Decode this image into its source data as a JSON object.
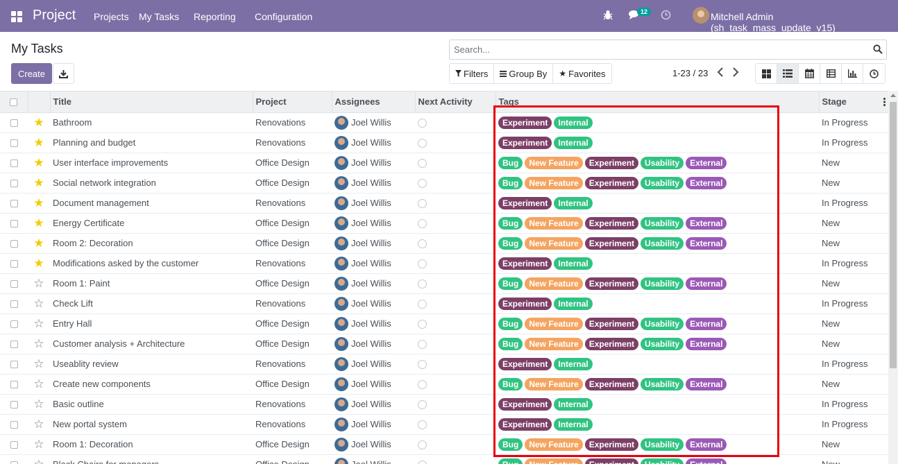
{
  "navbar": {
    "brand": "Project",
    "menu": [
      "Projects",
      "My Tasks",
      "Reporting",
      "Configuration"
    ],
    "messages_count": "12",
    "user": "Mitchell Admin (sh_task_mass_update_v15)"
  },
  "control": {
    "page_title": "My Tasks",
    "search_placeholder": "Search...",
    "create_label": "Create",
    "filters_label": "Filters",
    "groupby_label": "Group By",
    "favorites_label": "Favorites",
    "pager": "1-23 / 23"
  },
  "table": {
    "headers": [
      "Title",
      "Project",
      "Assignees",
      "Next Activity",
      "Tags",
      "Stage"
    ],
    "tag_colors": {
      "Experiment": "#7c3f66",
      "Internal": "#30c381",
      "Bug": "#30c381",
      "New Feature": "#f4a460",
      "Usability": "#30c381",
      "External": "#9b59b6"
    },
    "rows": [
      {
        "starred": true,
        "title": "Bathroom",
        "project": "Renovations",
        "assignee": "Joel Willis",
        "tags": [
          "Experiment",
          "Internal"
        ],
        "stage": "In Progress"
      },
      {
        "starred": true,
        "title": "Planning and budget",
        "project": "Renovations",
        "assignee": "Joel Willis",
        "tags": [
          "Experiment",
          "Internal"
        ],
        "stage": "In Progress"
      },
      {
        "starred": true,
        "title": "User interface improvements",
        "project": "Office Design",
        "assignee": "Joel Willis",
        "tags": [
          "Bug",
          "New Feature",
          "Experiment",
          "Usability",
          "External"
        ],
        "stage": "New"
      },
      {
        "starred": true,
        "title": "Social network integration",
        "project": "Office Design",
        "assignee": "Joel Willis",
        "tags": [
          "Bug",
          "New Feature",
          "Experiment",
          "Usability",
          "External"
        ],
        "stage": "New"
      },
      {
        "starred": true,
        "title": "Document management",
        "project": "Renovations",
        "assignee": "Joel Willis",
        "tags": [
          "Experiment",
          "Internal"
        ],
        "stage": "In Progress"
      },
      {
        "starred": true,
        "title": "Energy Certificate",
        "project": "Office Design",
        "assignee": "Joel Willis",
        "tags": [
          "Bug",
          "New Feature",
          "Experiment",
          "Usability",
          "External"
        ],
        "stage": "New"
      },
      {
        "starred": true,
        "title": "Room 2: Decoration",
        "project": "Office Design",
        "assignee": "Joel Willis",
        "tags": [
          "Bug",
          "New Feature",
          "Experiment",
          "Usability",
          "External"
        ],
        "stage": "New"
      },
      {
        "starred": true,
        "title": "Modifications asked by the customer",
        "project": "Renovations",
        "assignee": "Joel Willis",
        "tags": [
          "Experiment",
          "Internal"
        ],
        "stage": "In Progress"
      },
      {
        "starred": false,
        "title": "Room 1: Paint",
        "project": "Office Design",
        "assignee": "Joel Willis",
        "tags": [
          "Bug",
          "New Feature",
          "Experiment",
          "Usability",
          "External"
        ],
        "stage": "New"
      },
      {
        "starred": false,
        "title": "Check Lift",
        "project": "Renovations",
        "assignee": "Joel Willis",
        "tags": [
          "Experiment",
          "Internal"
        ],
        "stage": "In Progress"
      },
      {
        "starred": false,
        "title": "Entry Hall",
        "project": "Office Design",
        "assignee": "Joel Willis",
        "tags": [
          "Bug",
          "New Feature",
          "Experiment",
          "Usability",
          "External"
        ],
        "stage": "New"
      },
      {
        "starred": false,
        "title": "Customer analysis + Architecture",
        "project": "Office Design",
        "assignee": "Joel Willis",
        "tags": [
          "Bug",
          "New Feature",
          "Experiment",
          "Usability",
          "External"
        ],
        "stage": "New"
      },
      {
        "starred": false,
        "title": "Useablity review",
        "project": "Renovations",
        "assignee": "Joel Willis",
        "tags": [
          "Experiment",
          "Internal"
        ],
        "stage": "In Progress"
      },
      {
        "starred": false,
        "title": "Create new components",
        "project": "Office Design",
        "assignee": "Joel Willis",
        "tags": [
          "Bug",
          "New Feature",
          "Experiment",
          "Usability",
          "External"
        ],
        "stage": "New"
      },
      {
        "starred": false,
        "title": "Basic outline",
        "project": "Renovations",
        "assignee": "Joel Willis",
        "tags": [
          "Experiment",
          "Internal"
        ],
        "stage": "In Progress"
      },
      {
        "starred": false,
        "title": "New portal system",
        "project": "Renovations",
        "assignee": "Joel Willis",
        "tags": [
          "Experiment",
          "Internal"
        ],
        "stage": "In Progress"
      },
      {
        "starred": false,
        "title": "Room 1: Decoration",
        "project": "Office Design",
        "assignee": "Joel Willis",
        "tags": [
          "Bug",
          "New Feature",
          "Experiment",
          "Usability",
          "External"
        ],
        "stage": "New"
      },
      {
        "starred": false,
        "title": "Black Chairs for managers",
        "project": "Office Design",
        "assignee": "Joel Willis",
        "tags": [
          "Bug",
          "New Feature",
          "Experiment",
          "Usability",
          "External"
        ],
        "stage": "New"
      }
    ]
  }
}
